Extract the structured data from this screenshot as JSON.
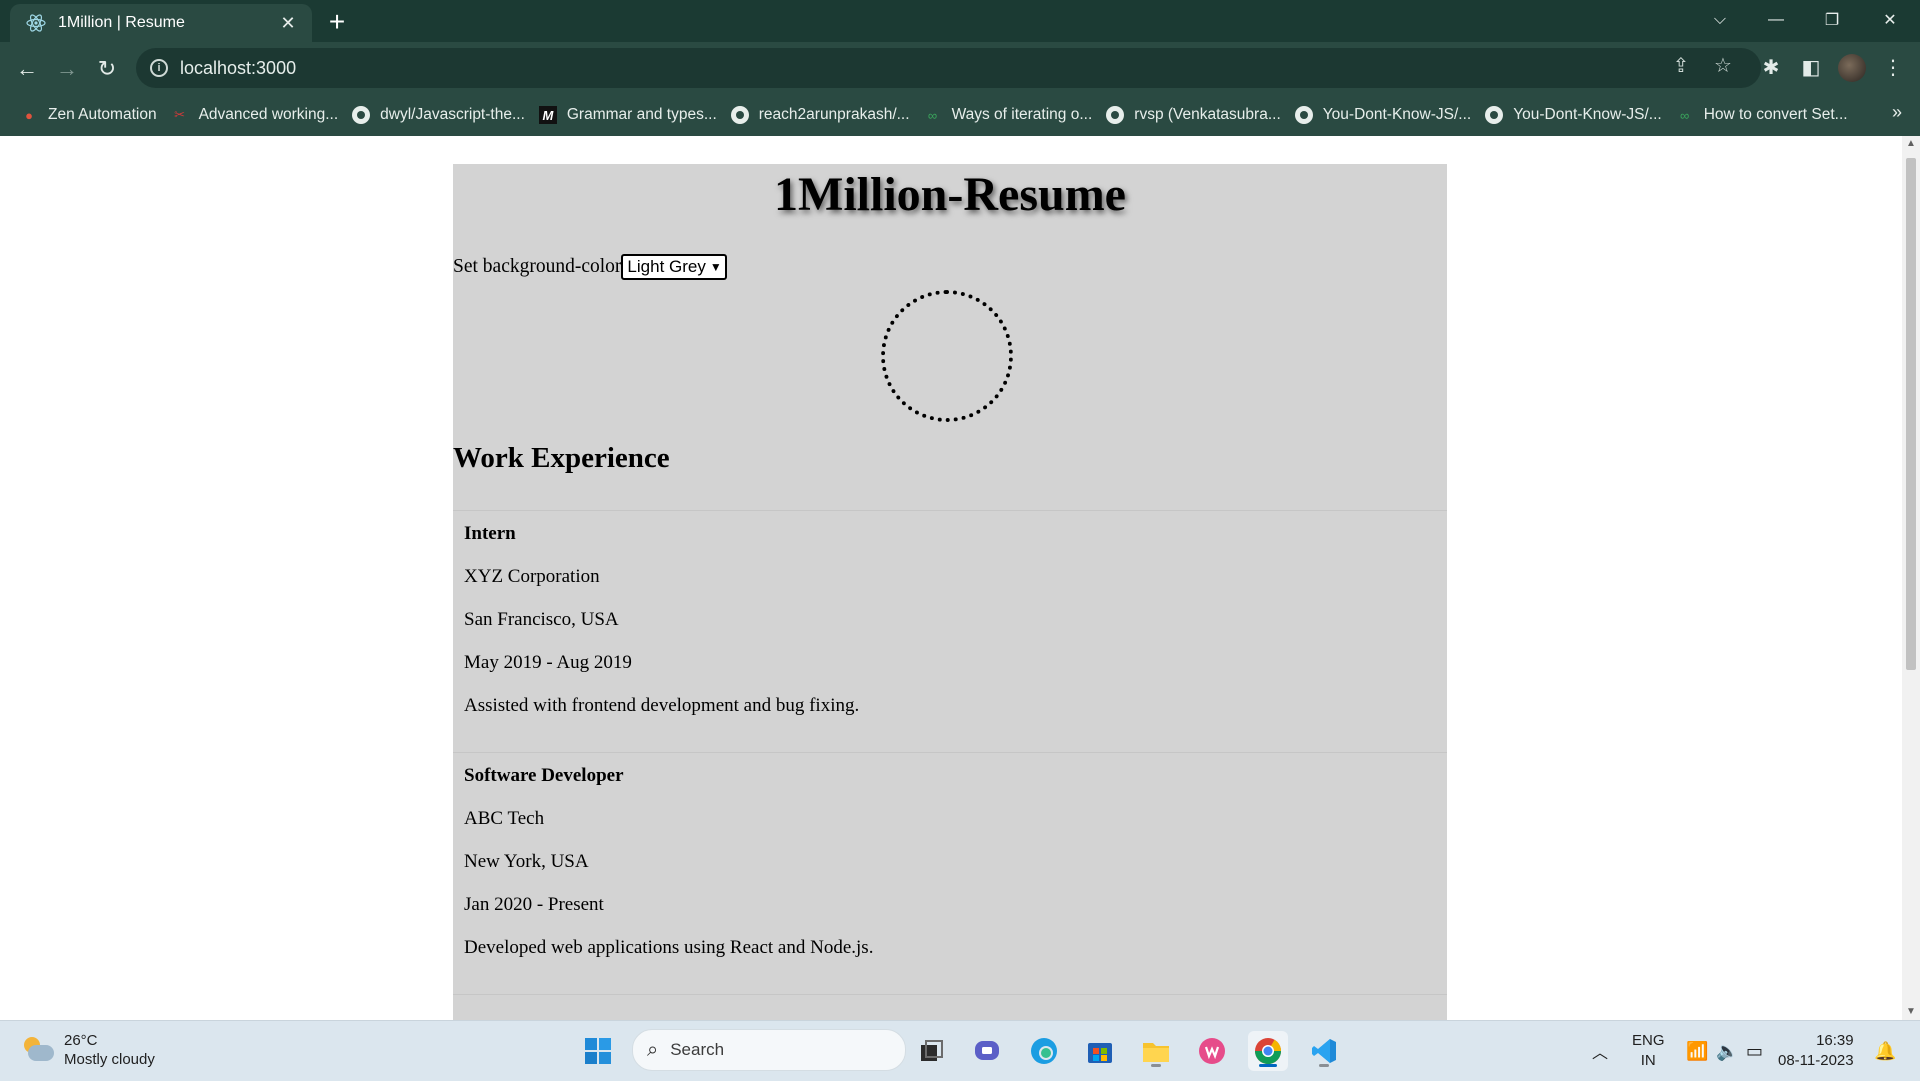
{
  "browser": {
    "tab_title": "1Million | Resume",
    "url": "localhost:3000",
    "bookmarks": [
      {
        "label": "Zen Automation",
        "icon": "zen-icon"
      },
      {
        "label": "Advanced working...",
        "icon": "scissors-icon"
      },
      {
        "label": "dwyl/Javascript-the...",
        "icon": "github-icon"
      },
      {
        "label": "Grammar and types...",
        "icon": "mdn-icon"
      },
      {
        "label": "reach2arunprakash/...",
        "icon": "github-icon"
      },
      {
        "label": "Ways of iterating o...",
        "icon": "link-icon"
      },
      {
        "label": "rvsp (Venkatasubra...",
        "icon": "github-icon"
      },
      {
        "label": "You-Dont-Know-JS/...",
        "icon": "github-icon"
      },
      {
        "label": "You-Dont-Know-JS/...",
        "icon": "github-icon"
      },
      {
        "label": "How to convert Set...",
        "icon": "link-icon"
      }
    ],
    "more_bookmarks": "»"
  },
  "page": {
    "title": "1Million-Resume",
    "bg_label": "Set background-color",
    "bg_selected": "Light Grey",
    "section_title": "Work Experience",
    "jobs": [
      {
        "role": "Intern",
        "company": "XYZ Corporation",
        "location": "San Francisco, USA",
        "period": "May 2019 - Aug 2019",
        "description": "Assisted with frontend development and bug fixing."
      },
      {
        "role": "Software Developer",
        "company": "ABC Tech",
        "location": "New York, USA",
        "period": "Jan 2020 - Present",
        "description": "Developed web applications using React and Node.js."
      }
    ]
  },
  "taskbar": {
    "weather_temp": "26°C",
    "weather_desc": "Mostly cloudy",
    "search_placeholder": "Search",
    "lang_1": "ENG",
    "lang_2": "IN",
    "time": "16:39",
    "date": "08-11-2023"
  },
  "colors": {
    "chrome_dark": "#1b3a33",
    "chrome_toolbar": "#2a4a42",
    "resume_bg": "#d3d3d3",
    "taskbar_bg": "#dbe6ee"
  }
}
